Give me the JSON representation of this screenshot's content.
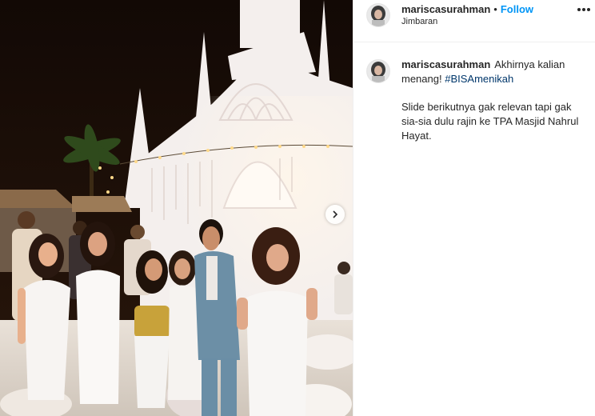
{
  "post": {
    "image_alt": "Group photo of guests in white outfits in front of an illuminated white chapel at night",
    "next_icon": "chevron-right-icon"
  },
  "header": {
    "username": "mariscasurahman",
    "separator": "•",
    "follow_label": "Follow",
    "location": "Jimbaran",
    "more_icon": "more-horizontal-icon"
  },
  "caption": {
    "username": "mariscasurahman",
    "text": "Akhirnya kalian menang!",
    "hashtag": "#BISAmenikah",
    "body": "Slide berikutnya gak relevan tapi gak sia-sia dulu rajin ke TPA Masjid Nahrul Hayat."
  },
  "colors": {
    "link_blue": "#0095f6",
    "hashtag_blue": "#00376b",
    "text": "#262626",
    "border": "#efefef"
  }
}
